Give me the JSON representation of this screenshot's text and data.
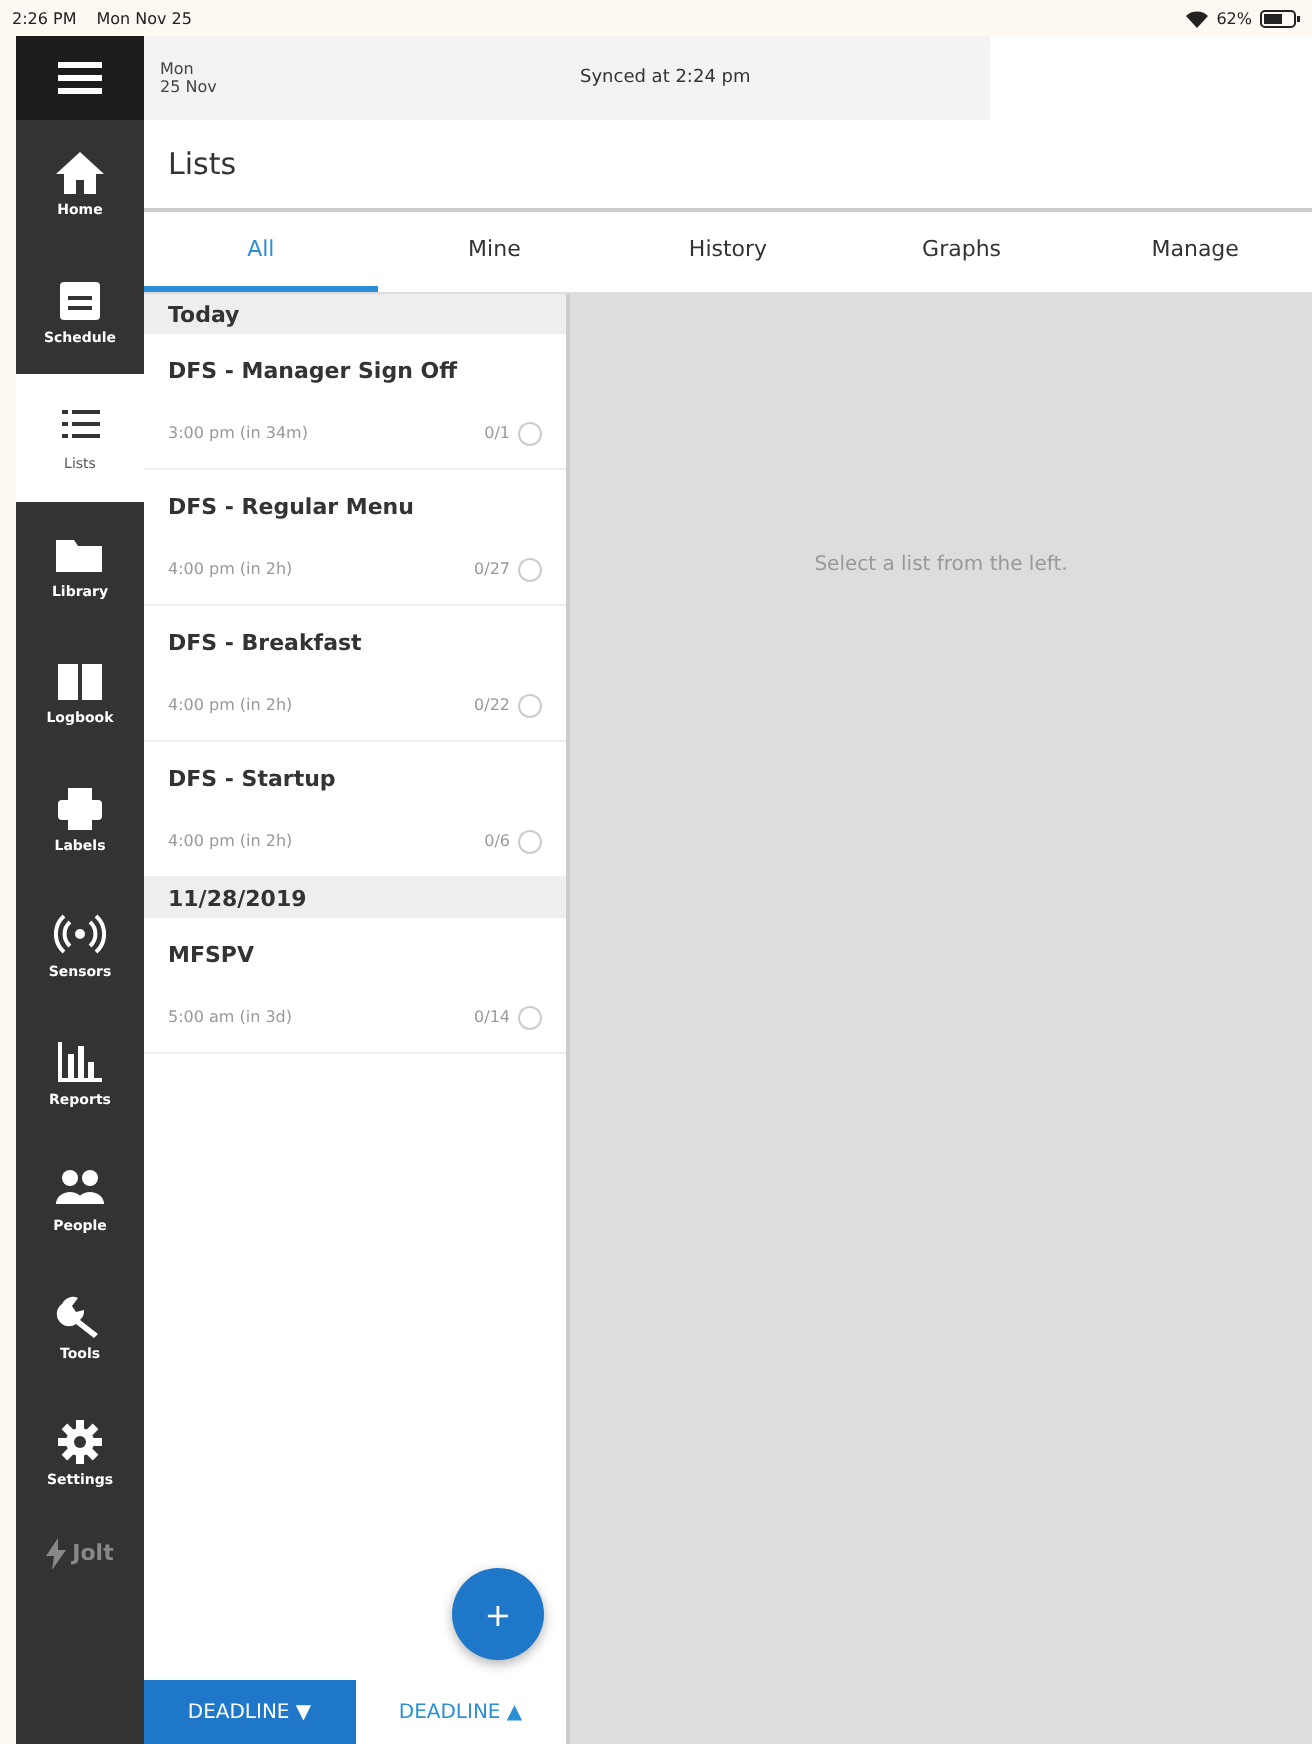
{
  "status_bar": {
    "time": "2:26 PM",
    "date": "Mon Nov 25",
    "battery": "62%"
  },
  "header": {
    "day": "Mon",
    "date": "25 Nov",
    "sync": "Synced at 2:24 pm"
  },
  "nav": [
    {
      "label": "Home",
      "selected": false
    },
    {
      "label": "Schedule",
      "selected": false
    },
    {
      "label": "Lists",
      "selected": true
    },
    {
      "label": "Library",
      "selected": false
    },
    {
      "label": "Logbook",
      "selected": false
    },
    {
      "label": "Labels",
      "selected": false
    },
    {
      "label": "Sensors",
      "selected": false
    },
    {
      "label": "Reports",
      "selected": false
    },
    {
      "label": "People",
      "selected": false
    },
    {
      "label": "Tools",
      "selected": false
    },
    {
      "label": "Settings",
      "selected": false
    }
  ],
  "brand": "Jolt",
  "page_title": "Lists",
  "tabs": [
    {
      "label": "All",
      "selected": true
    },
    {
      "label": "Mine",
      "selected": false
    },
    {
      "label": "History",
      "selected": false
    },
    {
      "label": "Graphs",
      "selected": false
    },
    {
      "label": "Manage",
      "selected": false
    }
  ],
  "groups": [
    {
      "heading": "Today",
      "items": [
        {
          "title": "DFS - Manager Sign Off",
          "due": "3:00 pm (in 34m)",
          "count": "0/1",
          "done": false
        },
        {
          "title": "DFS - Regular Menu",
          "due": "4:00 pm (in 2h)",
          "count": "0/27",
          "done": false
        },
        {
          "title": "DFS - Breakfast",
          "due": "4:00 pm (in 2h)",
          "count": "0/22",
          "done": false
        },
        {
          "title": "DFS - Startup",
          "due": "4:00 pm (in 2h)",
          "count": "0/6",
          "done": false
        }
      ]
    },
    {
      "heading": "11/28/2019",
      "items": [
        {
          "title": "MFSPV",
          "due": "5:00 am (in 3d)",
          "count": "0/14",
          "done": false
        }
      ]
    }
  ],
  "sort_buttons": [
    {
      "label": "DEADLINE ▼",
      "selected": true
    },
    {
      "label": "DEADLINE ▲",
      "selected": false
    }
  ],
  "fab": "+",
  "empty_message": "Select a list from the left."
}
